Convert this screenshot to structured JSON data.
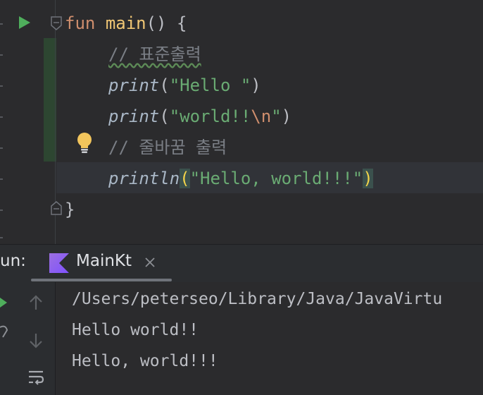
{
  "editor": {
    "line1": {
      "keyword": "fun",
      "name": "main",
      "rest": "() {"
    },
    "line2": {
      "comment": "// 표준출력"
    },
    "line3": {
      "fn": "print",
      "open": "(",
      "str": "\"Hello \"",
      "close": ")"
    },
    "line4": {
      "fn": "print",
      "open": "(",
      "str": "\"world!!",
      "escape": "\\n",
      "str_end": "\"",
      "close": ")"
    },
    "line5": {
      "comment": "// 줄바꿈 출력"
    },
    "line6": {
      "fn": "println",
      "open": "(",
      "str": "\"Hello, world!!!\"",
      "close": ")"
    },
    "line7": {
      "text": "}"
    }
  },
  "run_panel": {
    "label": "un:",
    "tab": {
      "label": "MainKt",
      "icon": "kotlin-icon"
    },
    "output": [
      "/Users/peterseo/Library/Java/JavaVirtu",
      "Hello world!!",
      "Hello, world!!!"
    ]
  },
  "colors": {
    "keyword": "#cf8e6d",
    "string": "#6aab73",
    "comment": "#7a7e85",
    "run_green": "#4fae5c",
    "bulb_yellow": "#f2c55c"
  },
  "icons": [
    "run-icon",
    "fold-icon",
    "bulb-icon",
    "kotlin-icon",
    "close-icon",
    "arrow-up-icon",
    "arrow-down-icon",
    "soft-wrap-icon"
  ]
}
